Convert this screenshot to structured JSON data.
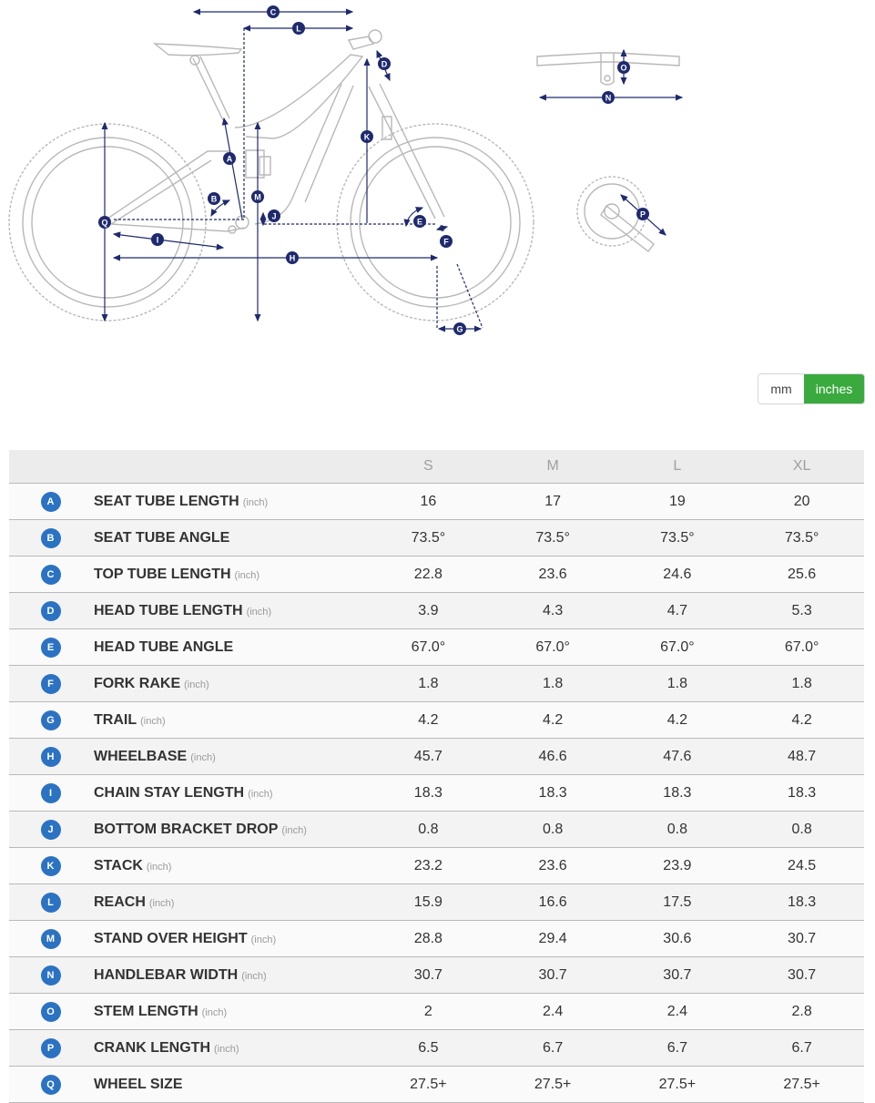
{
  "diagram": {
    "line_color": "#b8b8b8",
    "dim_color": "#1f2a6e",
    "markers": [
      "A",
      "B",
      "C",
      "D",
      "E",
      "F",
      "G",
      "H",
      "I",
      "J",
      "K",
      "L",
      "M",
      "N",
      "O",
      "P",
      "Q"
    ]
  },
  "unit_toggle": {
    "options": [
      {
        "label": "mm",
        "selected": false
      },
      {
        "label": "inches",
        "selected": true
      }
    ],
    "selected_color": "#3aaa3f"
  },
  "table": {
    "badge_color": "#2b72c2",
    "sizes": [
      "S",
      "M",
      "L",
      "XL"
    ],
    "rows": [
      {
        "key": "A",
        "label": "SEAT TUBE LENGTH",
        "unit": "(inch)",
        "values": [
          "16",
          "17",
          "19",
          "20"
        ]
      },
      {
        "key": "B",
        "label": "SEAT TUBE ANGLE",
        "unit": "",
        "values": [
          "73.5°",
          "73.5°",
          "73.5°",
          "73.5°"
        ]
      },
      {
        "key": "C",
        "label": "TOP TUBE LENGTH",
        "unit": "(inch)",
        "values": [
          "22.8",
          "23.6",
          "24.6",
          "25.6"
        ]
      },
      {
        "key": "D",
        "label": "HEAD TUBE LENGTH",
        "unit": "(inch)",
        "values": [
          "3.9",
          "4.3",
          "4.7",
          "5.3"
        ]
      },
      {
        "key": "E",
        "label": "HEAD TUBE ANGLE",
        "unit": "",
        "values": [
          "67.0°",
          "67.0°",
          "67.0°",
          "67.0°"
        ]
      },
      {
        "key": "F",
        "label": "FORK RAKE",
        "unit": "(inch)",
        "values": [
          "1.8",
          "1.8",
          "1.8",
          "1.8"
        ]
      },
      {
        "key": "G",
        "label": "TRAIL",
        "unit": "(inch)",
        "values": [
          "4.2",
          "4.2",
          "4.2",
          "4.2"
        ]
      },
      {
        "key": "H",
        "label": "WHEELBASE",
        "unit": "(inch)",
        "values": [
          "45.7",
          "46.6",
          "47.6",
          "48.7"
        ]
      },
      {
        "key": "I",
        "label": "CHAIN STAY LENGTH",
        "unit": "(inch)",
        "values": [
          "18.3",
          "18.3",
          "18.3",
          "18.3"
        ]
      },
      {
        "key": "J",
        "label": "BOTTOM BRACKET DROP",
        "unit": "(inch)",
        "values": [
          "0.8",
          "0.8",
          "0.8",
          "0.8"
        ]
      },
      {
        "key": "K",
        "label": "STACK",
        "unit": "(inch)",
        "values": [
          "23.2",
          "23.6",
          "23.9",
          "24.5"
        ]
      },
      {
        "key": "L",
        "label": "REACH",
        "unit": "(inch)",
        "values": [
          "15.9",
          "16.6",
          "17.5",
          "18.3"
        ]
      },
      {
        "key": "M",
        "label": "STAND OVER HEIGHT",
        "unit": "(inch)",
        "values": [
          "28.8",
          "29.4",
          "30.6",
          "30.7"
        ]
      },
      {
        "key": "N",
        "label": "HANDLEBAR WIDTH",
        "unit": "(inch)",
        "values": [
          "30.7",
          "30.7",
          "30.7",
          "30.7"
        ]
      },
      {
        "key": "O",
        "label": "STEM LENGTH",
        "unit": "(inch)",
        "values": [
          "2",
          "2.4",
          "2.4",
          "2.8"
        ]
      },
      {
        "key": "P",
        "label": "CRANK LENGTH",
        "unit": "(inch)",
        "values": [
          "6.5",
          "6.7",
          "6.7",
          "6.7"
        ]
      },
      {
        "key": "Q",
        "label": "WHEEL SIZE",
        "unit": "",
        "values": [
          "27.5+",
          "27.5+",
          "27.5+",
          "27.5+"
        ]
      }
    ]
  }
}
